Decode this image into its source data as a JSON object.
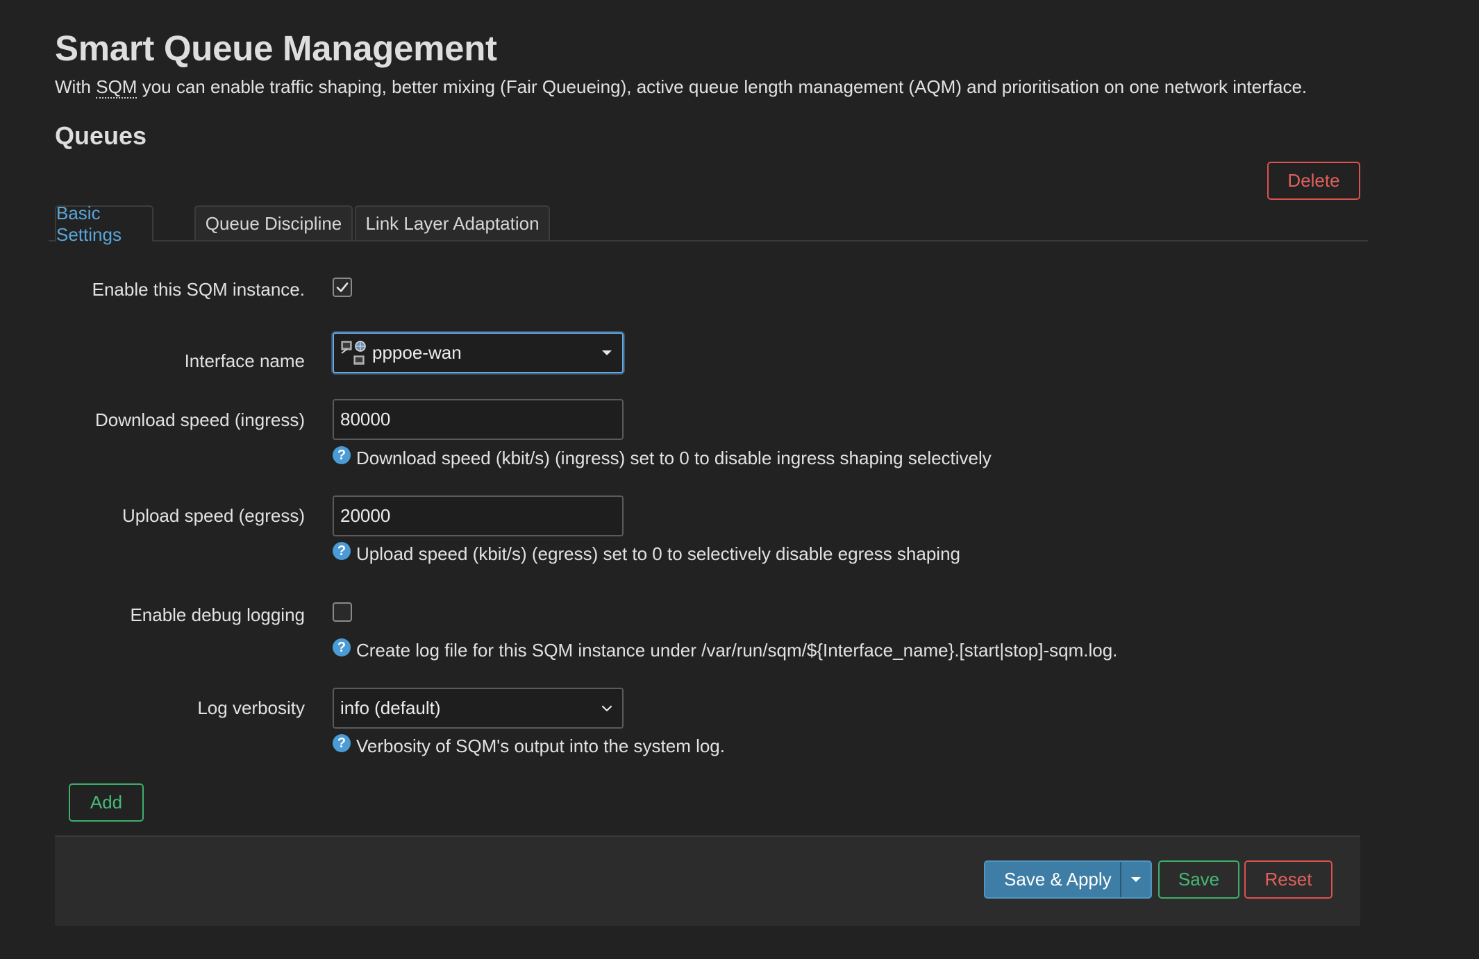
{
  "header": {
    "title": "Smart Queue Management",
    "description_prefix": "With ",
    "description_abbr": "SQM",
    "description_suffix": " you can enable traffic shaping, better mixing (Fair Queueing), active queue length management (AQM) and prioritisation on one network interface."
  },
  "section": {
    "title": "Queues",
    "delete_label": "Delete"
  },
  "tabs": [
    {
      "label": "Basic Settings",
      "active": true
    },
    {
      "label": "Queue Discipline",
      "active": false
    },
    {
      "label": "Link Layer Adaptation",
      "active": false
    }
  ],
  "form": {
    "enable": {
      "label": "Enable this SQM instance.",
      "checked": true
    },
    "interface": {
      "label": "Interface name",
      "value": "pppoe-wan"
    },
    "download": {
      "label": "Download speed (ingress)",
      "value": "80000",
      "help": "Download speed (kbit/s) (ingress) set to 0 to disable ingress shaping selectively"
    },
    "upload": {
      "label": "Upload speed (egress)",
      "value": "20000",
      "help": "Upload speed (kbit/s) (egress) set to 0 to selectively disable egress shaping"
    },
    "debug": {
      "label": "Enable debug logging",
      "checked": false,
      "help": "Create log file for this SQM instance under /var/run/sqm/${Interface_name}.[start|stop]-sqm.log."
    },
    "verbosity": {
      "label": "Log verbosity",
      "value": "info (default)",
      "help": "Verbosity of SQM's output into the system log."
    },
    "help_glyph": "?"
  },
  "actions": {
    "add_label": "Add",
    "save_apply_label": "Save & Apply",
    "save_label": "Save",
    "reset_label": "Reset"
  },
  "colors": {
    "background": "#222222",
    "accent_blue": "#5aa6dc",
    "positive_green": "#46b975",
    "negative_red": "#e0605c",
    "primary_button": "#3e7ea6"
  }
}
